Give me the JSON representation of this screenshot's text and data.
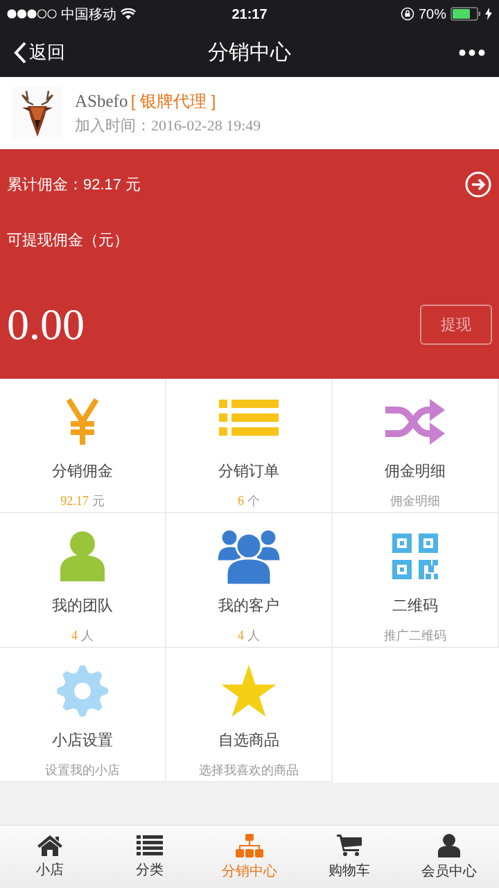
{
  "status_bar": {
    "carrier": "中国移动",
    "time": "21:17",
    "battery": "70%"
  },
  "nav": {
    "back": "返回",
    "title": "分销中心"
  },
  "profile": {
    "name": "ASbefo",
    "level": "[ 银牌代理 ]",
    "joined_label": "加入时间：",
    "joined": "2016-02-28 19:49"
  },
  "commission": {
    "total": "累计佣金：92.17 元",
    "withdrawable_label": "可提现佣金（元）",
    "amount": "0.00",
    "withdraw_button": "提现"
  },
  "grid": [
    {
      "title": "分销佣金",
      "kind": "count",
      "count": "92.17",
      "unit": "元"
    },
    {
      "title": "分销订单",
      "kind": "count",
      "count": "6",
      "unit": "个"
    },
    {
      "title": "佣金明细",
      "kind": "note",
      "note": "佣金明细"
    },
    {
      "title": "我的团队",
      "kind": "count",
      "count": "4",
      "unit": "人"
    },
    {
      "title": "我的客户",
      "kind": "count",
      "count": "4",
      "unit": "人"
    },
    {
      "title": "二维码",
      "kind": "note",
      "note": "推广二维码"
    },
    {
      "title": "小店设置",
      "kind": "note",
      "note": "设置我的小店"
    },
    {
      "title": "自选商品",
      "kind": "note",
      "note": "选择我喜欢的商品"
    }
  ],
  "tab_bar": [
    {
      "label": "小店",
      "selected": false
    },
    {
      "label": "分类",
      "selected": false
    },
    {
      "label": "分销中心",
      "selected": true
    },
    {
      "label": "购物车",
      "selected": false
    },
    {
      "label": "会员中心",
      "selected": false
    }
  ]
}
